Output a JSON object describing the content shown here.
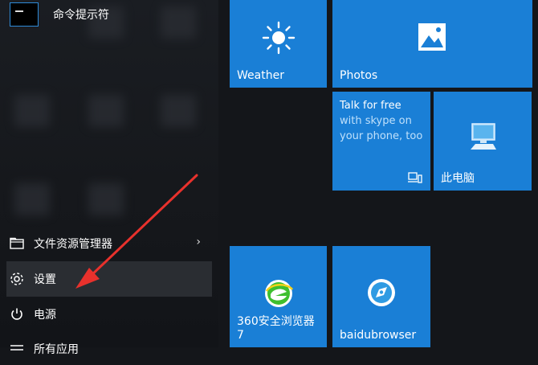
{
  "left_pane": {
    "top_app": {
      "label": "命令提示符",
      "icon": "cmd-prompt-icon"
    },
    "items": [
      {
        "label": "文件资源管理器",
        "icon": "file-explorer-icon",
        "has_submenu": true
      },
      {
        "label": "设置",
        "icon": "gear-icon",
        "highlighted": true
      },
      {
        "label": "电源",
        "icon": "power-icon"
      },
      {
        "label": "所有应用",
        "icon": "all-apps-icon"
      }
    ]
  },
  "tiles": {
    "weather": {
      "label": "Weather",
      "icon": "sun-icon"
    },
    "photos": {
      "label": "Photos",
      "icon": "photo-icon"
    },
    "skype": {
      "line1": "Talk for free",
      "line2": "with skype on your phone, too",
      "icon": "skype-device-icon"
    },
    "pc": {
      "label": "此电脑",
      "icon": "computer-icon"
    },
    "browser360": {
      "label": "360安全浏览器 7",
      "icon": "browser-360-icon"
    },
    "baidu": {
      "label": "baidubrowser",
      "icon": "baidu-browser-icon"
    }
  },
  "colors": {
    "tile": "#1a7fd6",
    "arrow": "#e8312c"
  }
}
